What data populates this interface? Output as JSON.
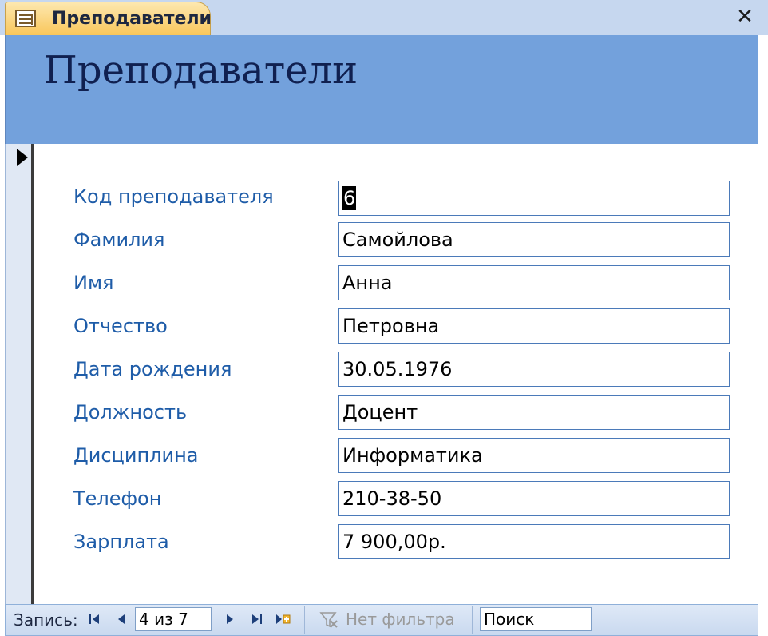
{
  "tab": {
    "label": "Преподаватели",
    "close_glyph": "✕"
  },
  "form": {
    "title": "Преподаватели",
    "fields": [
      {
        "label": "Код преподавателя",
        "value": "6"
      },
      {
        "label": "Фамилия",
        "value": "Самойлова"
      },
      {
        "label": "Имя",
        "value": "Анна"
      },
      {
        "label": "Отчество",
        "value": "Петровна"
      },
      {
        "label": "Дата рождения",
        "value": "30.05.1976"
      },
      {
        "label": "Должность",
        "value": "Доцент"
      },
      {
        "label": "Дисциплина",
        "value": "Информатика"
      },
      {
        "label": "Телефон",
        "value": "210-38-50"
      },
      {
        "label": "Зарплата",
        "value": "7 900,00р."
      }
    ]
  },
  "navbar": {
    "record_label": "Запись:",
    "current_record": "4 из 7",
    "filter_label": "Нет фильтра",
    "search_label": "Поиск"
  },
  "colors": {
    "header_bg": "#73a1dc",
    "tab_bg": "#f9c65a",
    "label_color": "#1e5ca8"
  }
}
